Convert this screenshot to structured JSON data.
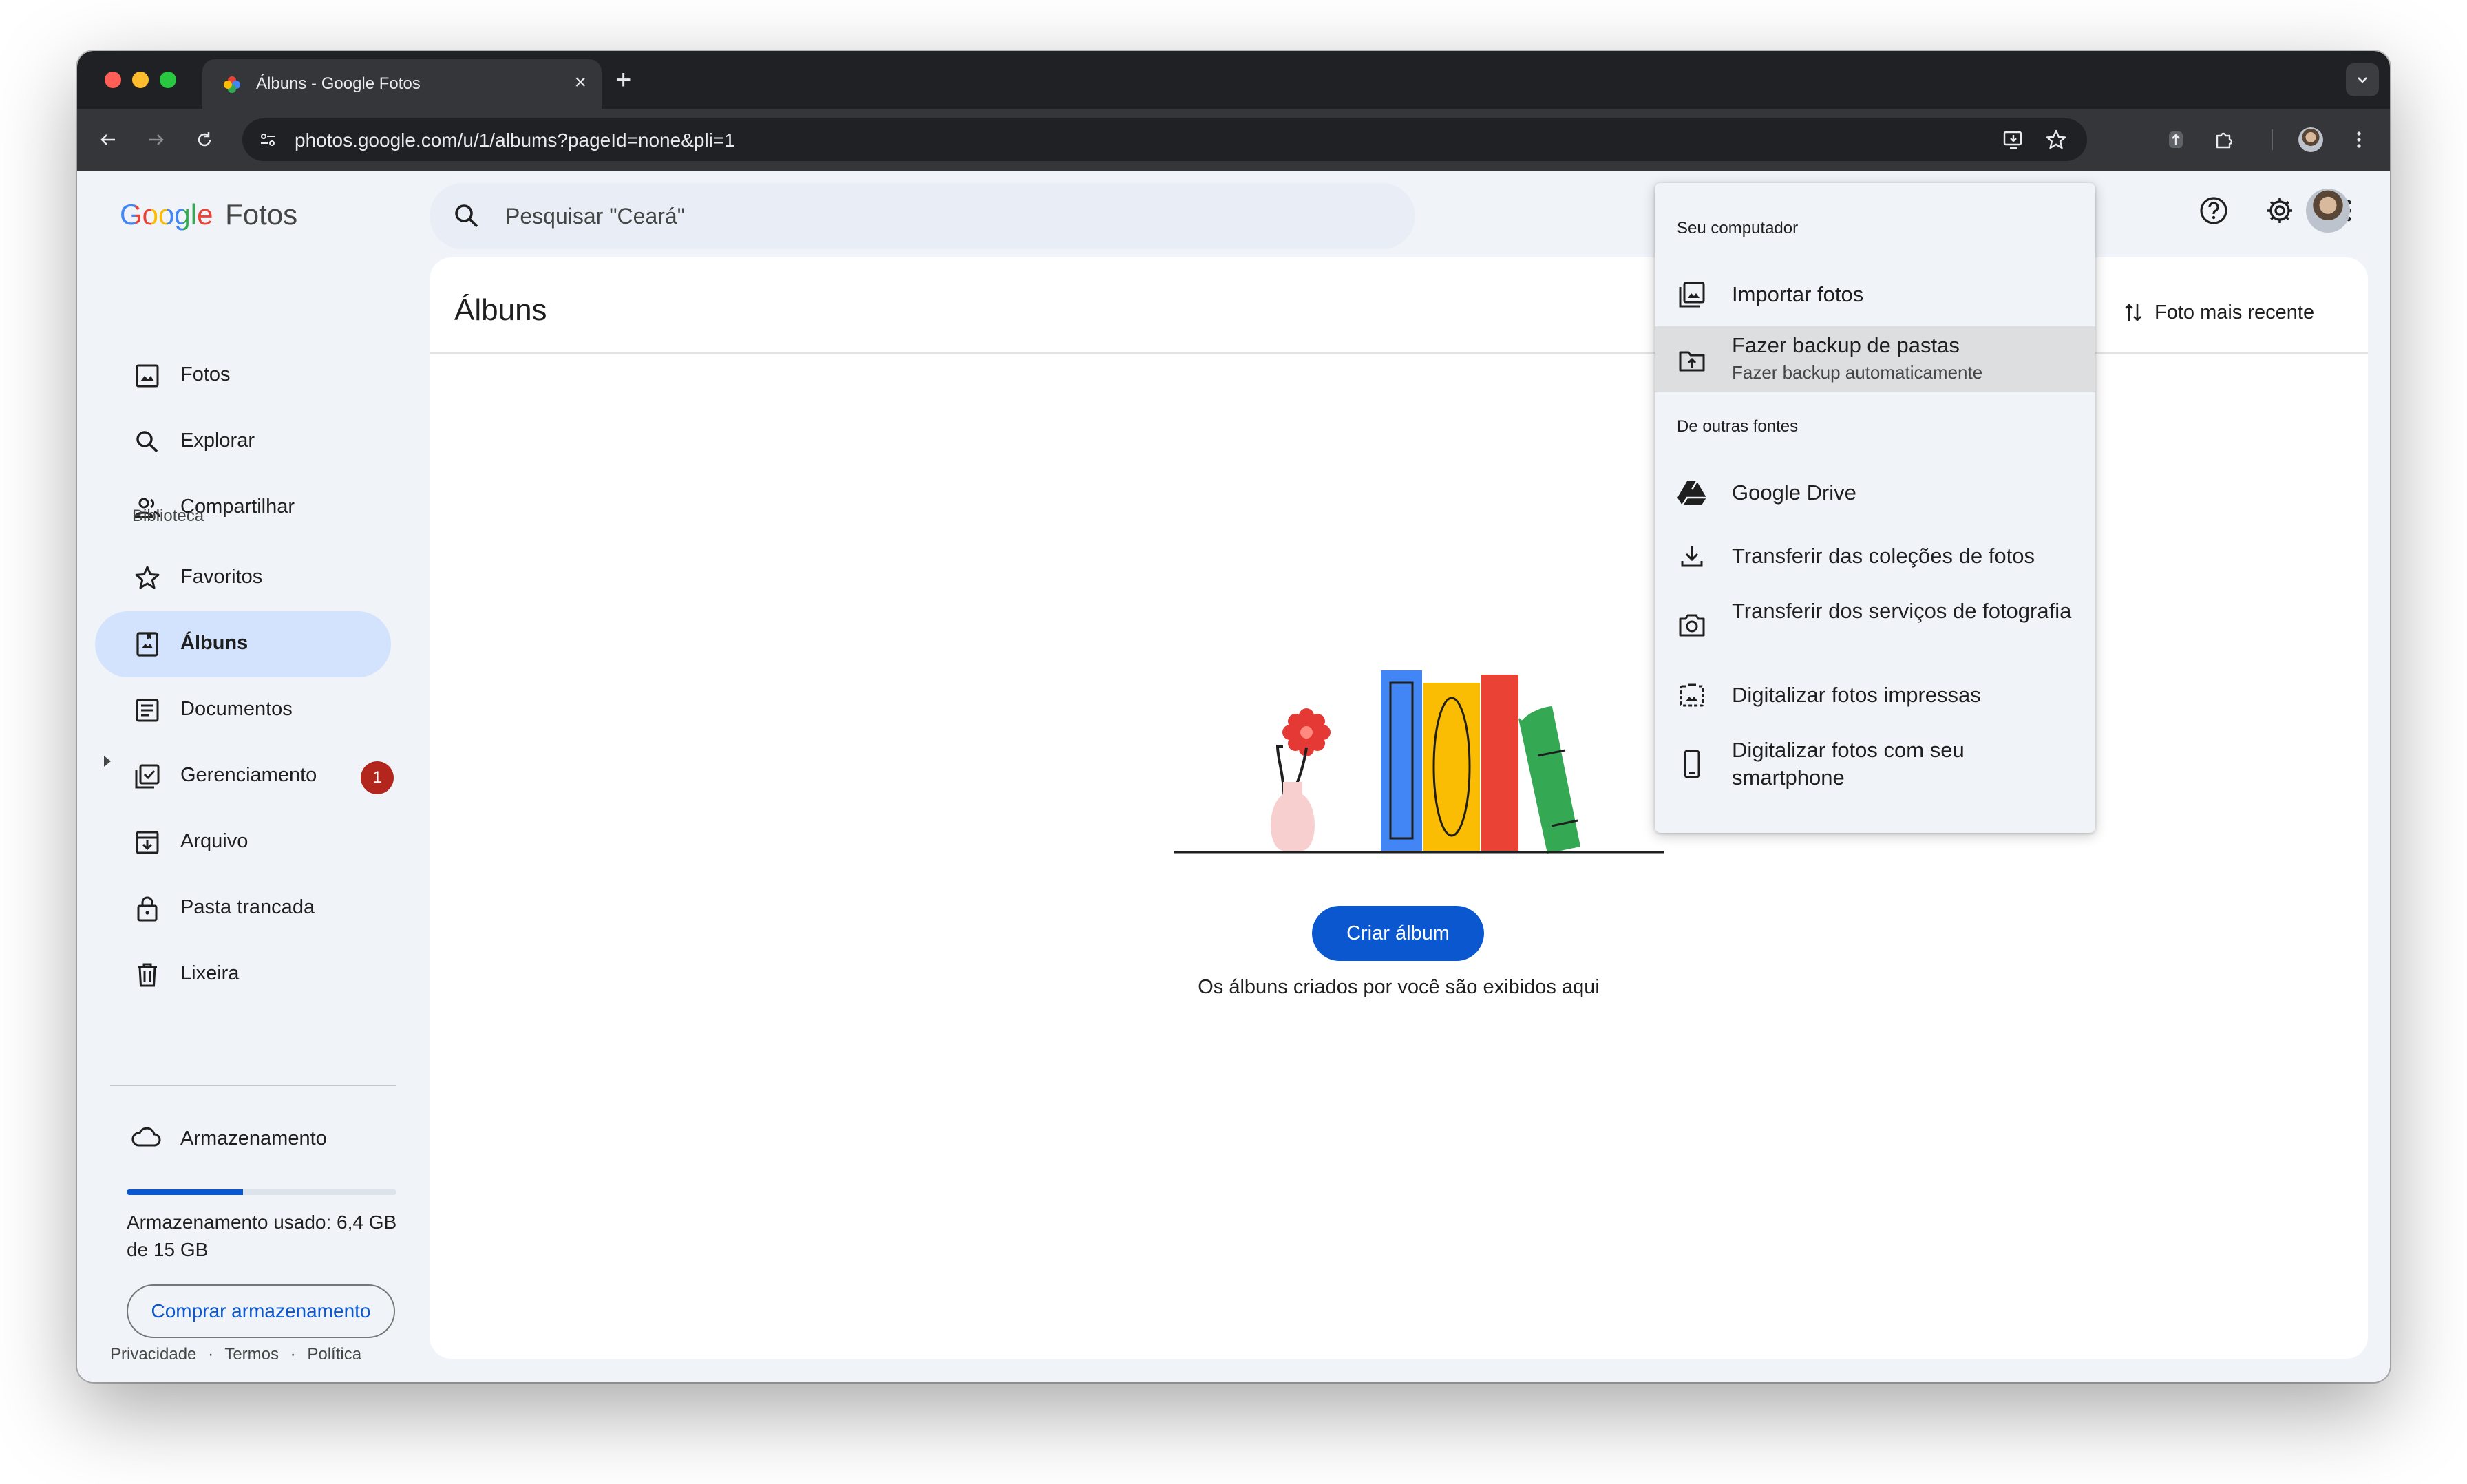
{
  "browser": {
    "tab_title": "Álbuns - Google Fotos",
    "url": "photos.google.com/u/1/albums?pageId=none&pli=1",
    "new_tab_symbol": "+",
    "close_symbol": "×"
  },
  "header": {
    "logo_google": "Google",
    "logo_product": "Fotos",
    "search_placeholder": "Pesquisar \"Ceará\""
  },
  "sidebar": {
    "items": [
      {
        "label": "Fotos"
      },
      {
        "label": "Explorar"
      },
      {
        "label": "Compartilhar"
      },
      {
        "label": "Favoritos"
      },
      {
        "label": "Álbuns"
      },
      {
        "label": "Documentos"
      },
      {
        "label": "Gerenciamento"
      },
      {
        "label": "Arquivo"
      },
      {
        "label": "Pasta trancada"
      },
      {
        "label": "Lixeira"
      }
    ],
    "section_library": "Biblioteca",
    "badge_count": "1",
    "storage_label": "Armazenamento",
    "storage_used_fraction": 0.43,
    "storage_text": "Armazenamento usado: 6,4 GB de 15 GB",
    "buy_button": "Comprar armazenamento",
    "footer_privacy": "Privacidade",
    "footer_terms": "Termos",
    "footer_policy": "Política",
    "footer_sep": "·"
  },
  "content": {
    "title": "Álbuns",
    "sort_label": "Foto mais recente",
    "create_button": "Criar álbum",
    "empty_text": "Os álbuns criados por você são exibidos aqui"
  },
  "menu": {
    "section_computer": "Seu computador",
    "section_other": "De outras fontes",
    "import_photos": "Importar fotos",
    "backup_folders": "Fazer backup de pastas",
    "backup_sub": "Fazer backup automaticamente",
    "google_drive": "Google Drive",
    "transfer_collections": "Transferir das coleções de fotos",
    "transfer_services": "Transferir dos serviços de fotografia",
    "scan_printed": "Digitalizar fotos impressas",
    "scan_phone": "Digitalizar fotos com seu smartphone"
  },
  "colors": {
    "accent": "#0b57d0",
    "active_nav": "#d3e3fd",
    "badge": "#b3261e",
    "page_bg": "#f0f4f9"
  }
}
